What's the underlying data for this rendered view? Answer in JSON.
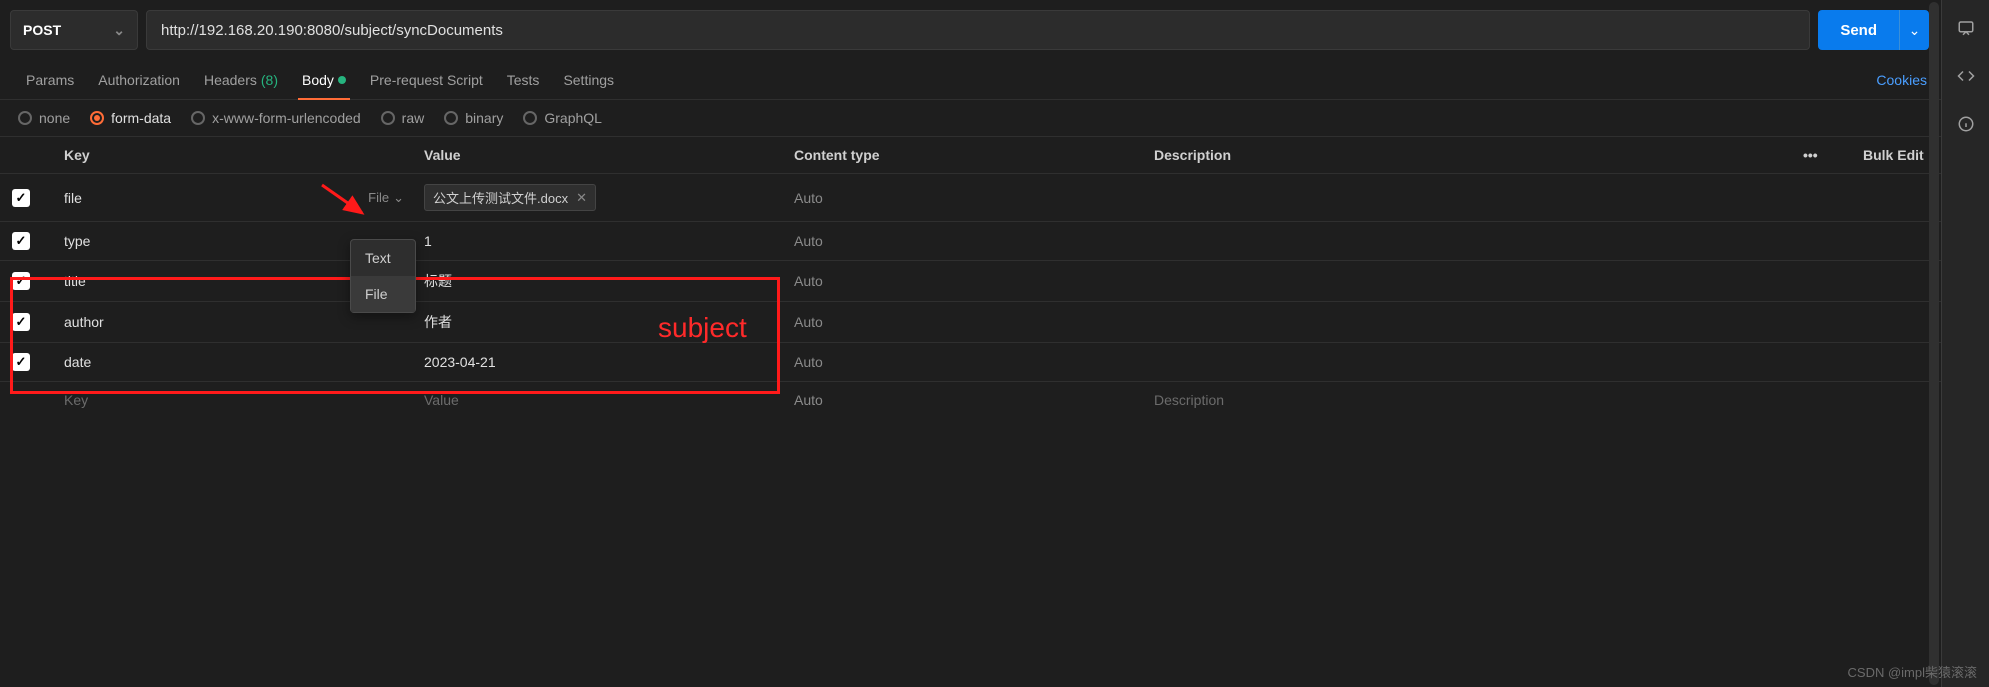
{
  "request": {
    "method": "POST",
    "url": "http://192.168.20.190:8080/subject/syncDocuments",
    "send_label": "Send"
  },
  "tabs": {
    "items": [
      {
        "key": "params",
        "label": "Params"
      },
      {
        "key": "auth",
        "label": "Authorization"
      },
      {
        "key": "headers",
        "label": "Headers",
        "count": "(8)"
      },
      {
        "key": "body",
        "label": "Body",
        "active": true,
        "dot": true
      },
      {
        "key": "prerequest",
        "label": "Pre-request Script"
      },
      {
        "key": "tests",
        "label": "Tests"
      },
      {
        "key": "settings",
        "label": "Settings"
      }
    ],
    "cookies_label": "Cookies"
  },
  "body_types": {
    "items": [
      {
        "key": "none",
        "label": "none"
      },
      {
        "key": "form-data",
        "label": "form-data",
        "selected": true
      },
      {
        "key": "urlencoded",
        "label": "x-www-form-urlencoded"
      },
      {
        "key": "raw",
        "label": "raw"
      },
      {
        "key": "binary",
        "label": "binary"
      },
      {
        "key": "graphql",
        "label": "GraphQL"
      }
    ]
  },
  "table": {
    "headers": {
      "key": "Key",
      "value": "Value",
      "content_type": "Content type",
      "description": "Description",
      "bulk_edit": "Bulk Edit",
      "more": "•••"
    },
    "rows": [
      {
        "enabled": true,
        "key": "file",
        "type_badge": "File",
        "value_file": "公文上传测试文件.docx",
        "content_type": "Auto",
        "description": ""
      },
      {
        "enabled": true,
        "key": "type",
        "value": "1",
        "content_type": "Auto",
        "description": ""
      },
      {
        "enabled": true,
        "key": "title",
        "value": "标题",
        "content_type": "Auto",
        "description": ""
      },
      {
        "enabled": true,
        "key": "author",
        "value": "作者",
        "content_type": "Auto",
        "description": ""
      },
      {
        "enabled": true,
        "key": "date",
        "value": "2023-04-21",
        "content_type": "Auto",
        "description": ""
      }
    ],
    "placeholder": {
      "key": "Key",
      "value": "Value",
      "content_type": "Auto",
      "description": "Description"
    }
  },
  "type_dropdown": {
    "items": [
      {
        "label": "Text"
      },
      {
        "label": "File",
        "selected": true
      }
    ]
  },
  "annotation": {
    "label": "subject"
  },
  "watermark": "CSDN @impl柴猿滚滚"
}
